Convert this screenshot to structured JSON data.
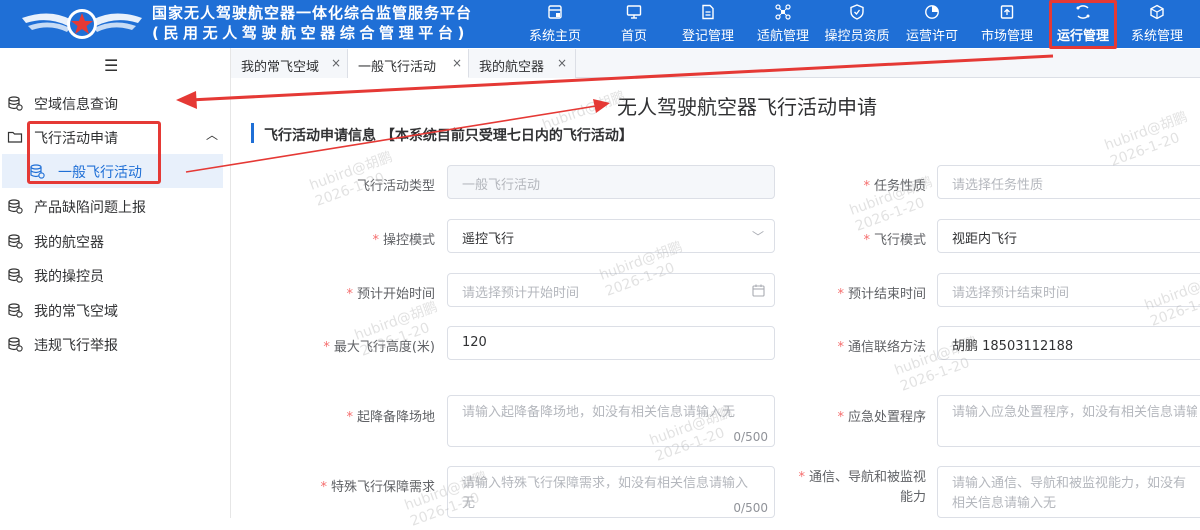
{
  "header": {
    "brand_line1": "国家无人驾驶航空器一体化综合监管服务平台",
    "brand_line2": "(民用无人驾驶航空器综合管理平台)",
    "nav": [
      {
        "label": "系统主页",
        "icon": "system-home-icon"
      },
      {
        "label": "首页",
        "icon": "monitor-icon"
      },
      {
        "label": "登记管理",
        "icon": "registration-icon"
      },
      {
        "label": "适航管理",
        "icon": "drone-icon"
      },
      {
        "label": "操控员资质",
        "icon": "shield-icon"
      },
      {
        "label": "运营许可",
        "icon": "pie-icon"
      },
      {
        "label": "市场管理",
        "icon": "upload-icon"
      },
      {
        "label": "运行管理",
        "icon": "operation-icon",
        "active": true
      },
      {
        "label": "系统管理",
        "icon": "cube-icon"
      }
    ]
  },
  "sidebar": {
    "items": [
      {
        "label": "空域信息查询"
      },
      {
        "label": "飞行活动申请",
        "expanded": true
      },
      {
        "label": "一般飞行活动",
        "selected": true
      },
      {
        "label": "产品缺陷问题上报"
      },
      {
        "label": "我的航空器"
      },
      {
        "label": "我的操控员"
      },
      {
        "label": "我的常飞空域"
      },
      {
        "label": "违规飞行举报"
      }
    ]
  },
  "tabs": [
    {
      "label": "我的常飞空域",
      "close": "×"
    },
    {
      "label": "一般飞行活动",
      "close": "×",
      "active": true
    },
    {
      "label": "我的航空器",
      "close": "×"
    }
  ],
  "page": {
    "title": "无人驾驶航空器飞行活动申请",
    "section_title": "飞行活动申请信息 【本系统目前只受理七日内的飞行活动】"
  },
  "form": {
    "activity_type": {
      "label": "飞行活动类型",
      "value": "一般飞行活动"
    },
    "task_nature": {
      "label": "任务性质",
      "placeholder": "请选择任务性质"
    },
    "control_mode": {
      "label": "操控模式",
      "value": "遥控飞行"
    },
    "flight_mode": {
      "label": "飞行模式",
      "value": "视距内飞行"
    },
    "start_time": {
      "label": "预计开始时间",
      "placeholder": "请选择预计开始时间"
    },
    "end_time": {
      "label": "预计结束时间",
      "placeholder": "请选择预计结束时间"
    },
    "max_height": {
      "label": "最大飞行高度(米)",
      "value": "120"
    },
    "contact": {
      "label": "通信联络方法",
      "value": "胡鹏 18503112188"
    },
    "landing_site": {
      "label": "起降备降场地",
      "placeholder": "请输入起降备降场地，如没有相关信息请输入无",
      "count": "0/500"
    },
    "emergency": {
      "label": "应急处置程序",
      "placeholder": "请输入应急处置程序，如没有相关信息请输入无"
    },
    "special_needs": {
      "label": "特殊飞行保障需求",
      "placeholder": "请输入特殊飞行保障需求，如没有相关信息请输入无",
      "count": "0/500"
    },
    "cns": {
      "label_line1": "通信、导航和被监视",
      "label_line2": "能力",
      "placeholder": "请输入通信、导航和被监视能力，如没有相关信息请输入无"
    },
    "required_mark": "*"
  },
  "watermark": {
    "user": "hubird@胡鹏",
    "date": "2026-1-20"
  },
  "colors": {
    "primary": "#1f6fd6",
    "annotation_red": "#e53935",
    "required": "#f56c6c"
  }
}
